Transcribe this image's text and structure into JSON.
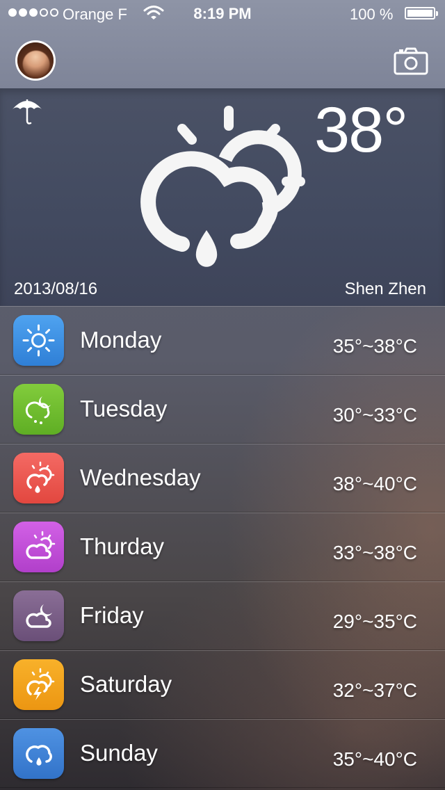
{
  "status_bar": {
    "carrier": "Orange F",
    "time": "8:19 PM",
    "battery": "100 %",
    "signal_bars": 3,
    "signal_total": 5
  },
  "header": {
    "avatar_icon": "user-avatar",
    "camera_icon": "camera-icon"
  },
  "current": {
    "temperature": "38°",
    "date": "2013/08/16",
    "city": "Shen Zhen",
    "condition_icon": "sun-cloud-rain-icon",
    "umbrella_icon": "umbrella-icon"
  },
  "forecast": [
    {
      "day": "Monday",
      "range": "35°~38°C",
      "icon": "sun-icon",
      "color": "#3a8fe0"
    },
    {
      "day": "Tuesday",
      "range": "30°~33°C",
      "icon": "cloud-moon-rain-icon",
      "color": "#6cbd2e"
    },
    {
      "day": "Wednesday",
      "range": "38°~40°C",
      "icon": "sun-cloud-rain-icon",
      "color": "#ef5a55"
    },
    {
      "day": "Thurday",
      "range": "33°~38°C",
      "icon": "sun-cloud-icon",
      "color": "#c14fd6"
    },
    {
      "day": "Friday",
      "range": "29°~35°C",
      "icon": "cloud-moon-icon",
      "color": "#7a5e86"
    },
    {
      "day": "Saturday",
      "range": "32°~37°C",
      "icon": "sun-cloud-thunder-icon",
      "color": "#f3a51c"
    },
    {
      "day": "Sunday",
      "range": "35°~40°C",
      "icon": "cloud-rain-icon",
      "color": "#3f84d8"
    }
  ]
}
